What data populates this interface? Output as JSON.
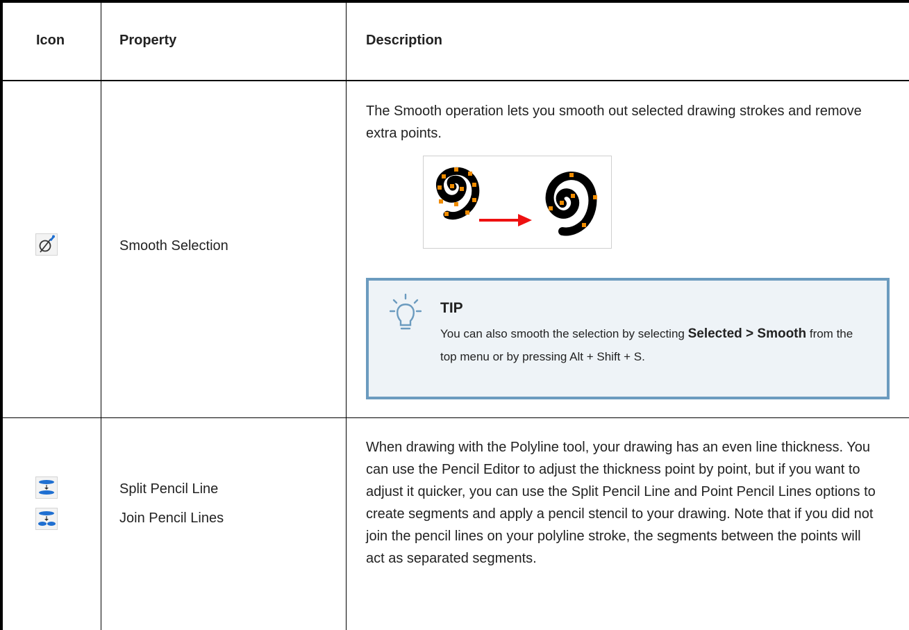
{
  "table": {
    "headers": {
      "icon": "Icon",
      "property": "Property",
      "description": "Description"
    },
    "rows": [
      {
        "icon": "smooth-selection-icon",
        "properties": [
          "Smooth Selection"
        ],
        "description": "The Smooth operation lets you smooth out selected drawing strokes and remove extra points.",
        "figure": "spiral-smooth-before-after",
        "tip": {
          "title": "TIP",
          "text_before": "You can also smooth the selection by selecting ",
          "bold_path": "Selected > Smooth",
          "text_after": " from the top menu or by pressing Alt + Shift + S."
        }
      },
      {
        "icons": [
          "split-pencil-line-icon",
          "join-pencil-lines-icon"
        ],
        "properties": [
          "Split Pencil Line",
          "Join Pencil Lines"
        ],
        "description": "When drawing with the Polyline tool, your drawing has an even line thickness. You can use the Pencil Editor to adjust the thickness point by point, but if you want to adjust it quicker, you can use the Split Pencil Line and Point Pencil Lines options to create segments and apply a pencil stencil to your drawing. Note that if you did not join the pencil lines on your polyline stroke, the segments between the points will act as separated segments."
      }
    ]
  },
  "colors": {
    "tip_border": "#6b9bbf",
    "tip_bg": "#eef3f7",
    "icon_blue": "#1f6fd1",
    "arrow_red": "#ee1111",
    "point_orange": "#f08c00"
  }
}
